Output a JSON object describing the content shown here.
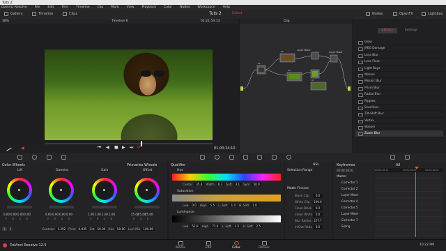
{
  "window": {
    "title": "Tuts 2"
  },
  "menu": [
    "DaVinci Resolve",
    "File",
    "Edit",
    "Trim",
    "Timeline",
    "Clip",
    "Mark",
    "View",
    "Playback",
    "Color",
    "Nodes",
    "Workspace",
    "Help"
  ],
  "topbar": {
    "gallery": "Gallery",
    "timeline": "Timeline",
    "clips": "Clips",
    "project": "Tuts 2",
    "edited": "Edited",
    "nodes": "Nodes",
    "openfx": "OpenFX",
    "lightbox": "Lightbox"
  },
  "viewer": {
    "zoom": "38%",
    "timeline_name": "Timeline 6",
    "timecode_top": "01:21:53:13",
    "timecode": "01:00:24:10"
  },
  "nodes": {
    "clip_label": "Clip",
    "layer_mixer_1": "Layer Mixer",
    "layer_mixer_2": "Layer Mixer",
    "n01": "01",
    "n02": "02",
    "n03": "03",
    "n04": "04",
    "n05": "05",
    "n06": "06",
    "n07": "07"
  },
  "fx": {
    "tab_library": "Library",
    "tab_settings": "Settings",
    "items": [
      "Glow",
      "JPEG Damage",
      "Lens Blur",
      "Lens Flare",
      "Light Rays",
      "Mirrors",
      "Mosaic Blur",
      "Prism Blur",
      "Radial Blur",
      "Ripples",
      "Scanlines",
      "Tilt-Shift Blur",
      "Vortex",
      "Warper",
      "Zoom Blur"
    ],
    "selected_index": 14
  },
  "wheels": {
    "title": "Color Wheels",
    "mode": "Primaries Wheels",
    "lift": {
      "label": "Lift",
      "nums": [
        "0.00",
        "0.00",
        "0.00",
        "0.00"
      ]
    },
    "gamma": {
      "label": "Gamma",
      "nums": [
        "0.00",
        "0.00",
        "0.00",
        "0.00"
      ]
    },
    "gain": {
      "label": "Gain",
      "nums": [
        "1.00",
        "1.00",
        "1.00",
        "1.00"
      ]
    },
    "offset": {
      "label": "Offset",
      "nums": [
        "25.00",
        "25.00",
        "25.00"
      ]
    },
    "channel_labels": [
      "Y",
      "R",
      "G",
      "B"
    ],
    "contrast_label": "Contrast",
    "contrast": "1.392",
    "pivot_label": "Pivot",
    "pivot": "0.435",
    "sat_label": "Sat",
    "sat": "50.00",
    "hue_label": "Hue",
    "hue": "50.00",
    "lummix_label": "Lum Mix",
    "lummix": "100.00"
  },
  "qualifier": {
    "title": "Qualifier",
    "mode": "HSL",
    "hue": {
      "label": "Hue",
      "center_l": "Center",
      "center": "35.4",
      "width_l": "Width",
      "width": "6.3",
      "soft_l": "Soft",
      "soft": "3.1",
      "sym_l": "Sym",
      "sym": "50.0"
    },
    "sat": {
      "label": "Saturation",
      "low_l": "Low",
      "low": "0.0",
      "high_l": "High",
      "high": "5.5",
      "lsoft_l": "L. Soft",
      "lsoft": "1.0",
      "hsoft_l": "H. Soft",
      "hsoft": "1.0"
    },
    "lum": {
      "label": "Luminance",
      "low_l": "Low",
      "low": "52.0",
      "high_l": "High",
      "high": "71.4",
      "lsoft_l": "L. Soft",
      "lsoft": "2.5",
      "hsoft_l": "H. Soft",
      "hsoft": "2.5"
    }
  },
  "range": {
    "title": "Selection Range",
    "matte_title": "Matte Finesse",
    "rows": [
      {
        "label": "Black Clip",
        "value": "0.0"
      },
      {
        "label": "White Clip",
        "value": "100.0"
      },
      {
        "label": "Clean Black",
        "value": "0.0"
      },
      {
        "label": "Clean White",
        "value": "0.0"
      },
      {
        "label": "Blur Radius",
        "value": "227.7"
      },
      {
        "label": "In/Out Ratio",
        "value": "0.0"
      }
    ]
  },
  "keyframes": {
    "title": "Keyframes",
    "filter": "All",
    "tc": "00:00:28:01",
    "tc_a": "00:00:28:12",
    "tc_b": "00:01:08:03",
    "tc_c": "00:01:16:03",
    "rows": [
      "Master",
      "Corrector 1",
      "Corrector 2",
      "Layer Mixer",
      "Corrector 4",
      "Corrector 5",
      "Layer Mixer",
      "Corrector 7",
      "Sizing"
    ]
  },
  "pages": {
    "app": "DaVinci Resolve 12.5",
    "media": "Media",
    "edit": "Edit",
    "color": "Color",
    "deliver": "Deliver"
  },
  "taskbar": {
    "time": "10:22 PM"
  }
}
